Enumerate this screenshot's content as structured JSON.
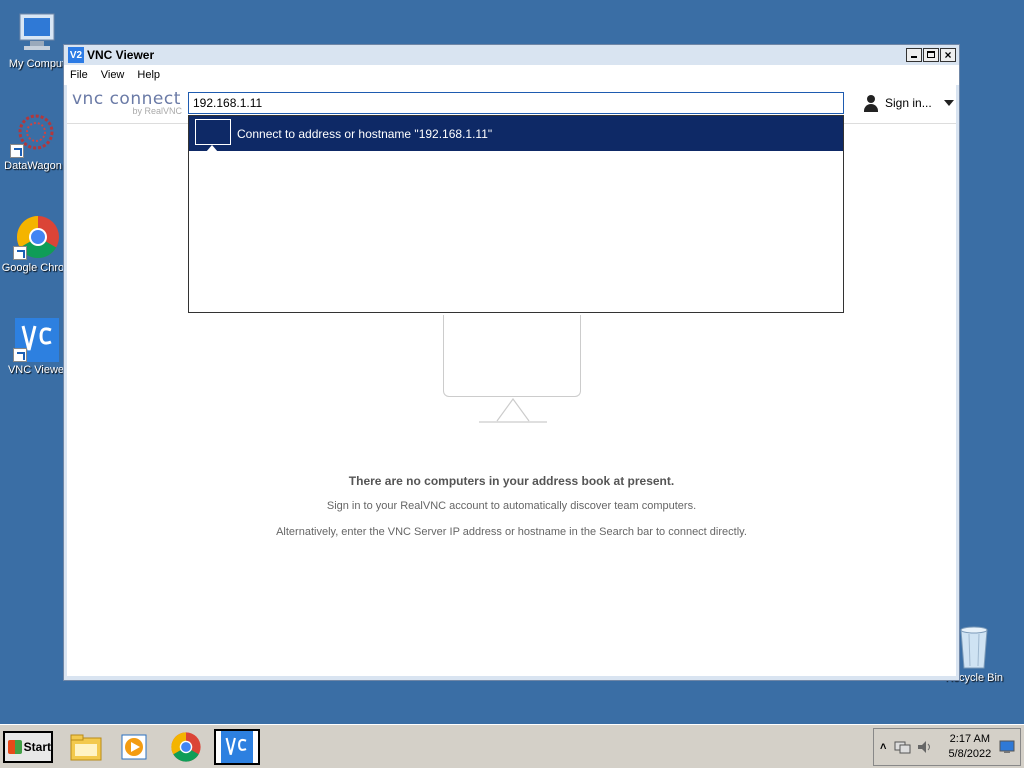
{
  "desktop": {
    "icons": [
      {
        "label": "My Comput"
      },
      {
        "label": "DataWagon"
      },
      {
        "label": "Google Chron"
      },
      {
        "label": "VNC Viewe"
      },
      {
        "label": "Recycle Bin"
      }
    ]
  },
  "window": {
    "title": "VNC Viewer",
    "app_icon_text": "V2",
    "close_glyph": "×",
    "menu": [
      "File",
      "View",
      "Help"
    ],
    "logo": {
      "main": "vnc connect",
      "sub": "by RealVNC"
    },
    "search": {
      "value": "192.168.1.11"
    },
    "signin": {
      "label": "Sign in..."
    },
    "dropdown": {
      "items": [
        {
          "label": "Connect to address or hostname \"192.168.1.11\""
        }
      ]
    },
    "empty_state": {
      "heading": "There are no computers in your address book at present.",
      "line1": "Sign in to your RealVNC account to automatically discover team computers.",
      "line2": "Alternatively, enter the VNC Server IP address or hostname in the Search bar to connect directly."
    }
  },
  "taskbar": {
    "start_label": "Start",
    "pinned": [
      "file-explorer",
      "media-player",
      "chrome",
      "vnc-viewer"
    ],
    "tray": {
      "time": "2:17 AM",
      "date": "5/8/2022",
      "expand_glyph": "˄"
    }
  },
  "colors": {
    "desktop": "#3a6ea5",
    "dropdown_highlight": "#0e2966",
    "search_border": "#1e5bb0"
  }
}
